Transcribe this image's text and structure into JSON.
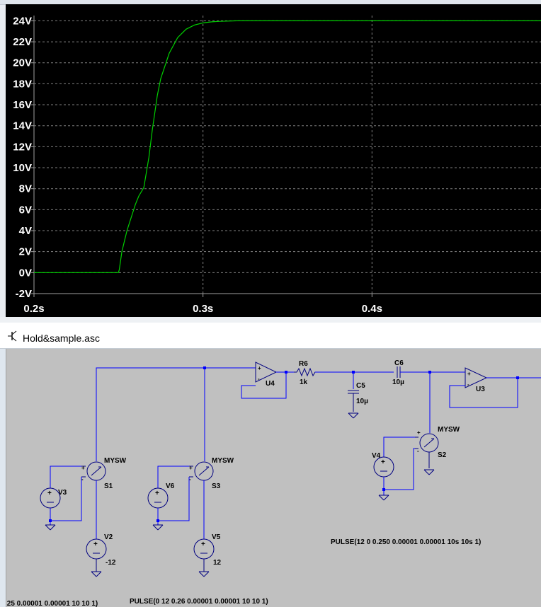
{
  "plot": {
    "chart_data": {
      "type": "line",
      "xlim": [
        0.2,
        0.5
      ],
      "ylim": [
        -2,
        24.5
      ],
      "x_ticks": [
        0.2,
        0.3,
        0.4
      ],
      "x_tick_labels": [
        "0.2s",
        "0.3s",
        "0.4s"
      ],
      "y_ticks": [
        -2,
        0,
        2,
        4,
        6,
        8,
        10,
        12,
        14,
        16,
        18,
        20,
        22,
        24
      ],
      "y_tick_labels": [
        "-2V",
        "0V",
        "2V",
        "4V",
        "6V",
        "8V",
        "10V",
        "12V",
        "14V",
        "16V",
        "18V",
        "20V",
        "22V",
        "24V"
      ],
      "grid": true,
      "series": [
        {
          "color": "#00d000",
          "x": [
            0.2,
            0.25,
            0.2505,
            0.252,
            0.255,
            0.26,
            0.262,
            0.265,
            0.268,
            0.27,
            0.273,
            0.275,
            0.28,
            0.285,
            0.29,
            0.295,
            0.3,
            0.305,
            0.31,
            0.32,
            0.33,
            0.35,
            0.4,
            0.5
          ],
          "y": [
            0,
            0,
            0.3,
            2.0,
            4.0,
            6.5,
            7.3,
            8.1,
            11.0,
            13.6,
            16.9,
            18.5,
            20.9,
            22.4,
            23.2,
            23.6,
            23.8,
            23.9,
            23.95,
            24.0,
            24.0,
            24.0,
            24.0,
            24.0
          ]
        }
      ]
    }
  },
  "schematic": {
    "title": "Hold&sample.asc",
    "labels": {
      "u4": "U4",
      "u3": "U3",
      "r6": "R6",
      "r6_value": "1k",
      "c5": "C5",
      "c5_value": "10µ",
      "c6": "C6",
      "c6_value": "10µ",
      "s1_model": "MYSW",
      "s1": "S1",
      "s3_model": "MYSW",
      "s3": "S3",
      "s2_model": "MYSW",
      "s2": "S2",
      "v3": "V3",
      "v6": "V6",
      "v4": "V4",
      "v2": "V2",
      "v2_value": "-12",
      "v5": "V5",
      "v5_value": "12",
      "pulse_v4": "PULSE(12 0 0.250 0.00001 0.00001 10s 10s 1)",
      "pulse_v6": "PULSE(0 12 0.26 0.00001 0.00001 10 10 1)",
      "pulse_v3_partial": ".25 0.00001 0.00001 10 10 1)"
    }
  }
}
